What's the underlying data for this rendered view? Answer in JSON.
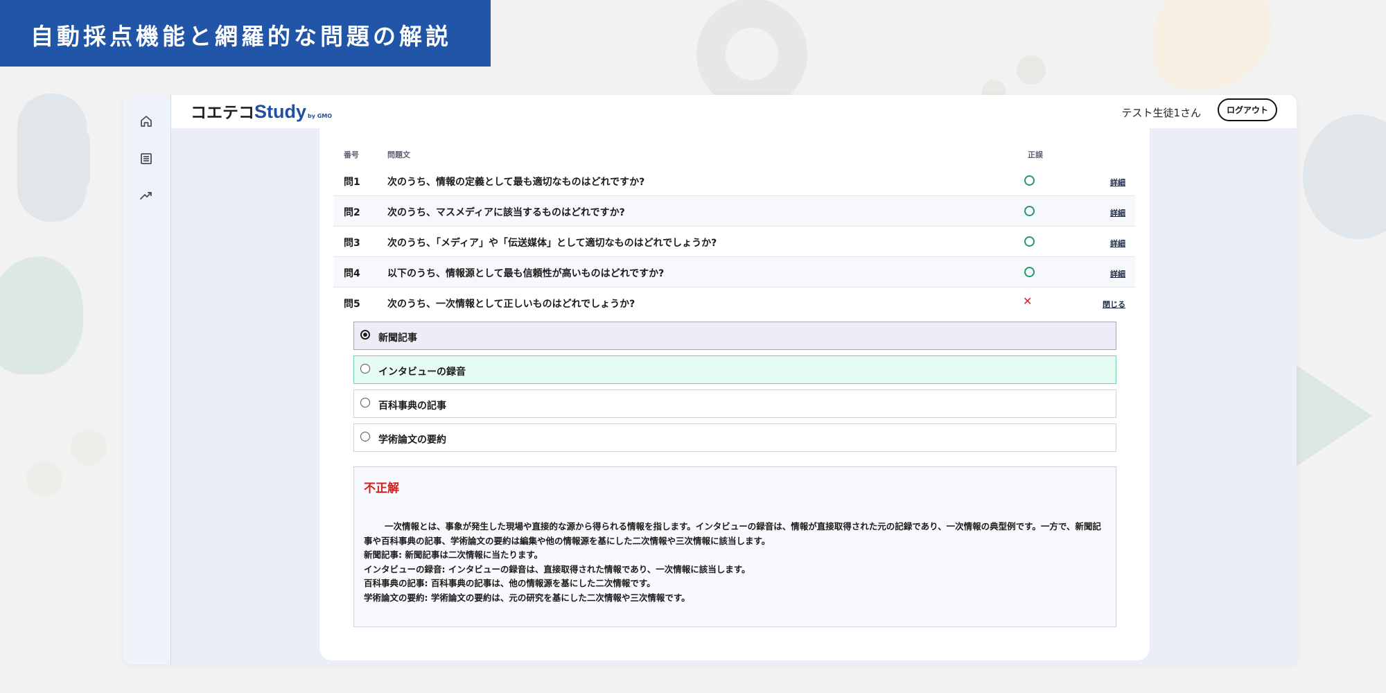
{
  "banner": {
    "title": "自動採点機能と網羅的な問題の解説"
  },
  "header": {
    "logo_jp": "コエテコ",
    "logo_en": "Study",
    "logo_sub": "by GMO",
    "user_name": "テスト生徒1さん",
    "logout_label": "ログアウト"
  },
  "sidebar": {
    "items": [
      {
        "icon": "home-icon"
      },
      {
        "icon": "list-icon"
      },
      {
        "icon": "trending-up-icon"
      }
    ]
  },
  "table": {
    "headers": {
      "number": "番号",
      "question": "問題文",
      "result": "正誤"
    },
    "rows": [
      {
        "number": "問1",
        "question": "次のうち、情報の定義として最も適切なものはどれですか?",
        "result": "correct",
        "action": "詳細"
      },
      {
        "number": "問2",
        "question": "次のうち、マスメディアに該当するものはどれですか?",
        "result": "correct",
        "action": "詳細"
      },
      {
        "number": "問3",
        "question": "次のうち、「メディア」や「伝送媒体」として適切なものはどれでしょうか?",
        "result": "correct",
        "action": "詳細"
      },
      {
        "number": "問4",
        "question": "以下のうち、情報源として最も信頼性が高いものはどれですか?",
        "result": "correct",
        "action": "詳細"
      },
      {
        "number": "問5",
        "question": "次のうち、一次情報として正しいものはどれでしょうか?",
        "result": "incorrect",
        "action": "閉じる"
      }
    ]
  },
  "answer": {
    "options": [
      {
        "label": "新聞記事",
        "state": "selected"
      },
      {
        "label": "インタビューの録音",
        "state": "correct"
      },
      {
        "label": "百科事典の記事",
        "state": "none"
      },
      {
        "label": "学術論文の要約",
        "state": "none"
      }
    ],
    "verdict": "不正解",
    "explanation": [
      "一次情報とは、事象が発生した現場や直接的な源から得られる情報を指します。インタビューの録音は、情報が直接取得された元の記録であり、一次情報の典型例です。一方で、新聞記事や百科事典の記事、学術論文の要約は編集や他の情報源を基にした二次情報や三次情報に該当します。",
      "新聞記事: 新聞記事は二次情報に当たります。",
      "インタビューの録音: インタビューの録音は、直接取得された情報であり、一次情報に該当します。",
      "百科事典の記事: 百科事典の記事は、他の情報源を基にした二次情報です。",
      "学術論文の要約: 学術論文の要約は、元の研究を基にした二次情報や三次情報です。"
    ]
  },
  "colors": {
    "banner": "#2055a7",
    "correct_mark": "#1e9a6a",
    "incorrect_mark": "#d81e1e",
    "verdict_text": "#d41f1f",
    "correct_option_bg": "#e5faf0",
    "selected_option_bg": "#edecf7"
  }
}
